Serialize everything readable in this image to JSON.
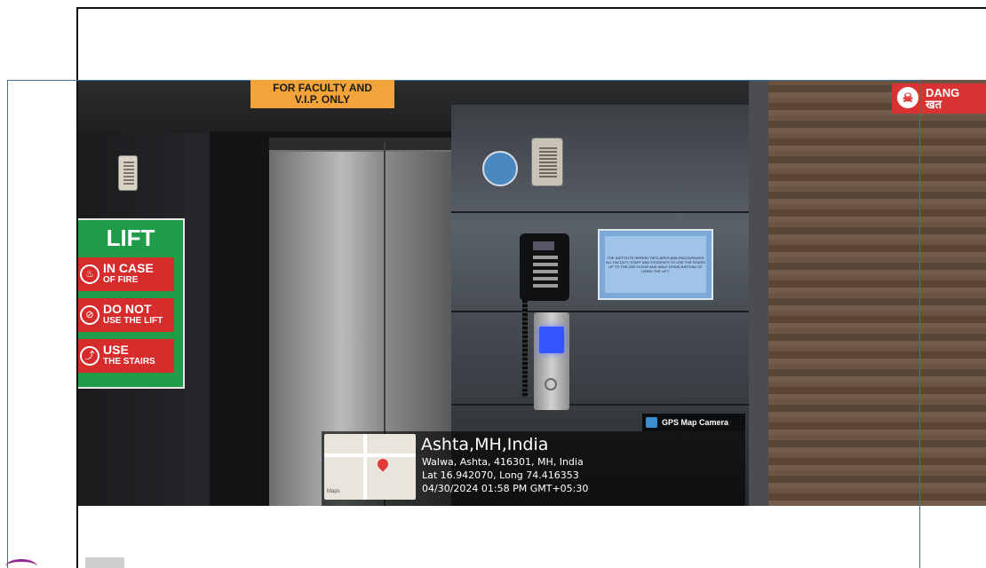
{
  "photo": {
    "signs": {
      "vip": [
        "FOR FACULTY AND",
        "V.I.P. ONLY"
      ],
      "lift": {
        "title": "LIFT",
        "rows": [
          {
            "main": "IN CASE",
            "sub": "OF FIRE"
          },
          {
            "main": "DO NOT",
            "sub": "USE THE LIFT"
          },
          {
            "main": "USE",
            "sub": "THE STAIRS"
          }
        ]
      },
      "danger": [
        "DANG",
        "खत"
      ],
      "notice": "THE INSTITUTE HEREBY DECLARES AND ENCOURAGES ALL FACULTY, STAFF AND STUDENTS TO USE THE STAIRS UP TO THE 2ND FLOOR AND WALK DOWN INSTEAD OF USING THE LIFT."
    },
    "gps": {
      "app_label": "GPS Map Camera",
      "title": "Ashta,MH,India",
      "address": "Walwa, Ashta, 416301, MH, India",
      "coords": "Lat 16.942070, Long 74.416353",
      "datetime": "04/30/2024 01:58 PM GMT+05:30",
      "map_credit": "Maps"
    }
  },
  "colors": {
    "lift_sign_green": "#1f9c48",
    "lift_sign_red": "#d62c2c",
    "vip_sign_orange": "#f2a33a",
    "danger_red": "#d93232",
    "frame_blue": "#3f6f9a"
  }
}
